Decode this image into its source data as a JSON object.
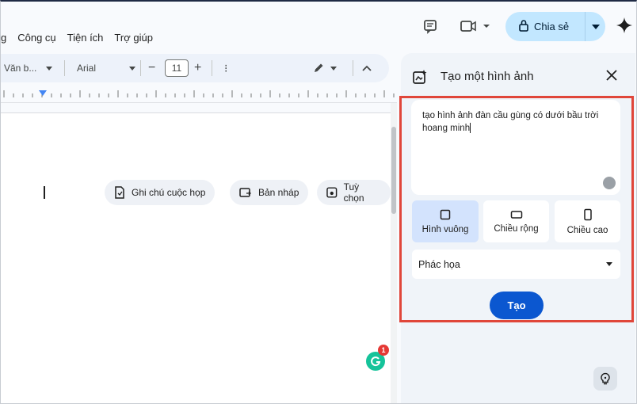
{
  "menu": [
    "g",
    "Công cụ",
    "Tiện ích",
    "Trợ giúp"
  ],
  "toolbar": {
    "style_label": "Văn b...",
    "font_label": "Arial",
    "font_size": "11",
    "minus": "−",
    "plus": "+",
    "more": "⁝"
  },
  "share": {
    "label": "Chia sẻ"
  },
  "chips": [
    {
      "label": "Ghi chú cuộc họp",
      "icon": "document-icon"
    },
    {
      "label": "Bản nháp",
      "icon": "email-draft-icon"
    },
    {
      "label": "Tuỳ chọn",
      "icon": "options-icon"
    }
  ],
  "panel": {
    "title": "Tạo một hình ảnh",
    "prompt_text": "tạo hình ảnh đàn cầu gùng có dưới bầu trời hoang minh",
    "shapes": [
      {
        "label": "Hình vuông",
        "selected": true
      },
      {
        "label": "Chiều rộng",
        "selected": false
      },
      {
        "label": "Chiều cao",
        "selected": false
      }
    ],
    "style_value": "Phác họa",
    "create_label": "Tạo"
  },
  "grammarly_badge": "1",
  "colors": {
    "accent": "#0b57d0",
    "share_bg": "#c2e7ff",
    "highlight": "#e0463a",
    "selected_shape": "#d3e3fd"
  }
}
